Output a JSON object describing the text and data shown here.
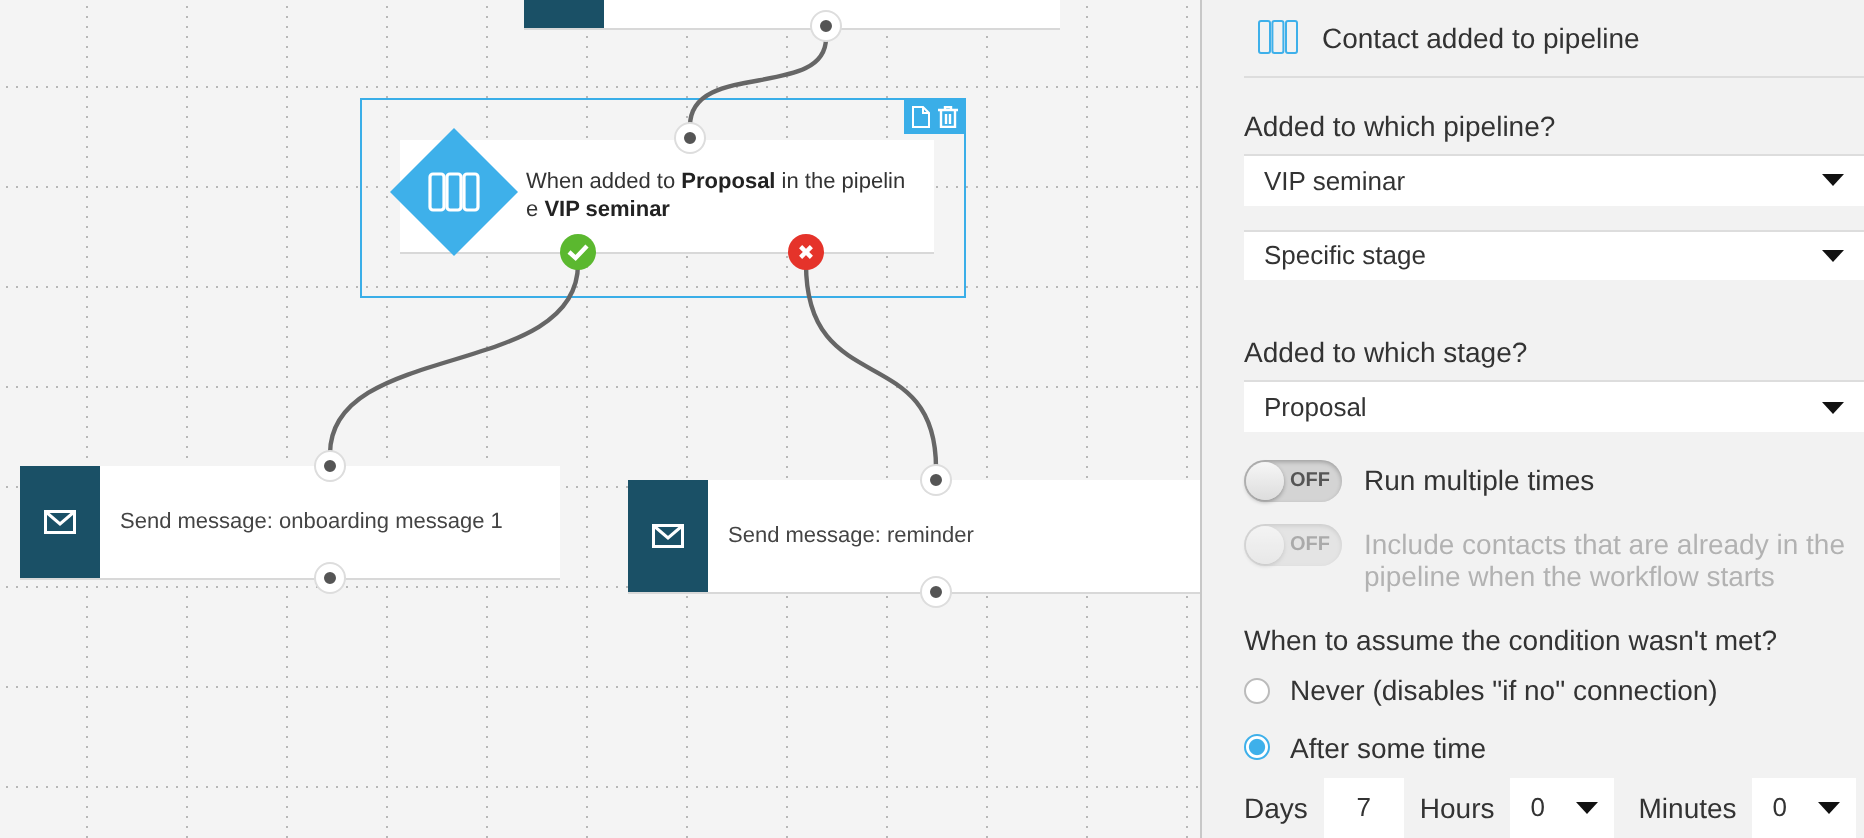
{
  "canvas": {
    "nodes": [
      {
        "kind": "action_stub"
      },
      {
        "kind": "condition",
        "text": "When added to **Proposal** in the pipeline **VIP seminar**",
        "selected": true
      },
      {
        "kind": "action",
        "text": "Send message: onboarding message 1",
        "selected": false
      },
      {
        "kind": "action",
        "text": "Send message: reminder",
        "selected": false
      }
    ]
  },
  "panel": {
    "title": "Contact added to pipeline",
    "fields": [
      {
        "kind": "label",
        "text": "Added to which pipeline?"
      },
      {
        "kind": "select",
        "value": "VIP seminar"
      },
      {
        "kind": "select",
        "value": "Specific stage"
      },
      {
        "kind": "label",
        "text": "Added to which stage?"
      },
      {
        "kind": "select",
        "value": "Proposal"
      },
      {
        "kind": "toggle",
        "state_label": "OFF",
        "on": false,
        "disabled": false,
        "text": "Run multiple times"
      },
      {
        "kind": "toggle",
        "state_label": "OFF",
        "on": false,
        "disabled": true,
        "text": "Include contacts that are already in the pipeline when the workflow starts"
      },
      {
        "kind": "label",
        "text": "When to assume the condition wasn't met?"
      },
      {
        "kind": "radio",
        "text": "Never (disables \"if no\" connection)",
        "selected": false
      },
      {
        "kind": "radio",
        "text": "After some time",
        "selected": true
      }
    ],
    "delay": [
      {
        "label": "Days",
        "kind": "input",
        "value": "7"
      },
      {
        "label": "Hours",
        "kind": "select",
        "value": "0"
      },
      {
        "label": "Minutes",
        "kind": "select",
        "value": "0"
      }
    ]
  }
}
